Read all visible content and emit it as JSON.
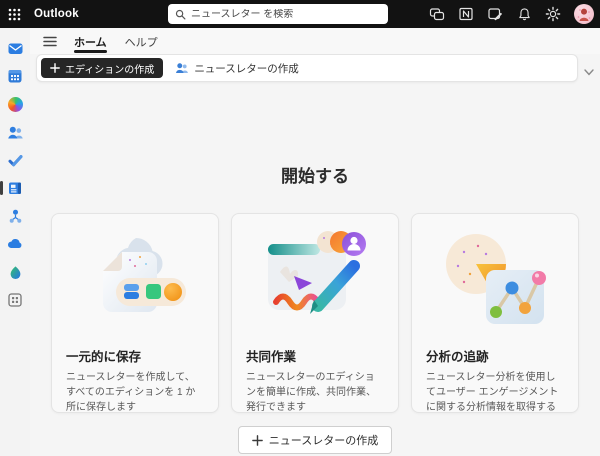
{
  "topbar": {
    "app_name": "Outlook",
    "search": {
      "placeholder": "ニュースレター を検索"
    },
    "icons": [
      "chat-icon",
      "onenote-feed-icon",
      "notes-icon",
      "bell-icon",
      "gear-icon",
      "avatar"
    ]
  },
  "sidebar": {
    "icons": [
      "mail-icon",
      "calendar-icon",
      "copilot-icon",
      "people-icon",
      "todo-icon",
      "newsletter-icon",
      "org-icon",
      "onedrive-icon",
      "places-icon",
      "apps-icon"
    ],
    "selected_icon": "newsletter-icon"
  },
  "tabs": {
    "items": [
      {
        "label": "ホーム",
        "active": true
      },
      {
        "label": "ヘルプ",
        "active": false
      }
    ]
  },
  "toolbar": {
    "create_edition_label": "エディションの作成",
    "create_newsletter_label": "ニュースレターの作成"
  },
  "main": {
    "heading": "開始する",
    "cards": [
      {
        "title": "一元的に保存",
        "description": "ニュースレターを作成して、すべてのエディションを 1 か所に保存します"
      },
      {
        "title": "共同作業",
        "description": "ニュースレターのエディションを簡単に作成、共同作業、発行できます"
      },
      {
        "title": "分析の追跡",
        "description": "ニュースレター分析を使用してユーザー エンゲージメントに関する分析情報を取得する"
      }
    ],
    "cta_label": "ニュースレターの作成"
  },
  "colors": {
    "topbar_bg": "#121212",
    "accent_blue": "#2e7ee0",
    "page_bg": "#f5f5f5",
    "primary_button_bg": "#262626"
  }
}
